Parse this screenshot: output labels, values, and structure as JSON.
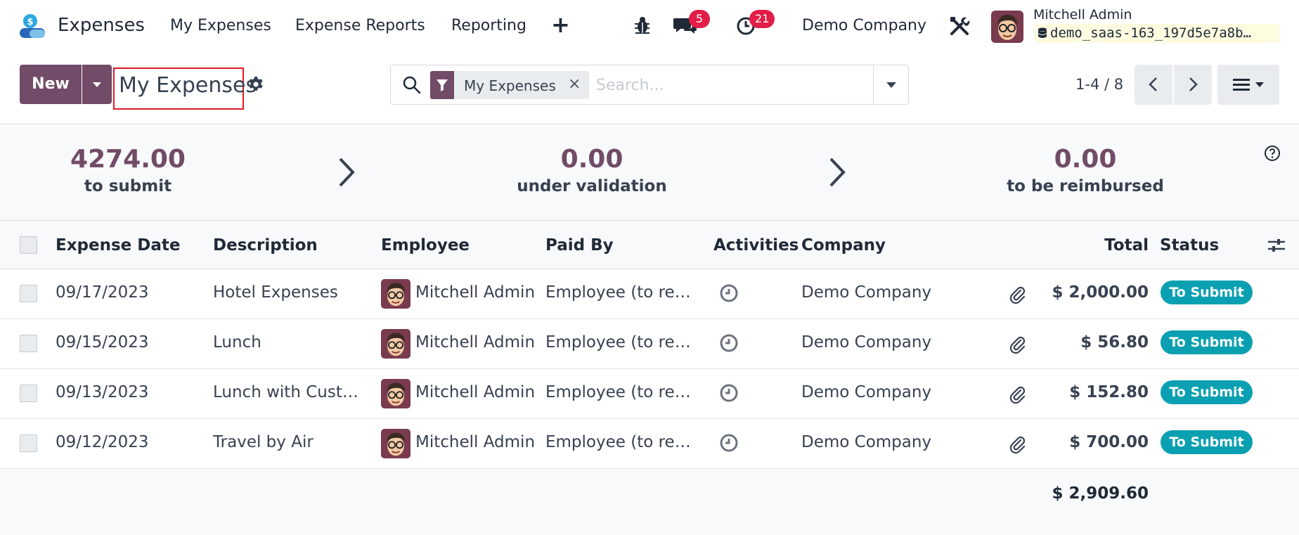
{
  "navbar": {
    "app_title": "Expenses",
    "menu": [
      "My Expenses",
      "Expense Reports",
      "Reporting"
    ],
    "messages_count": "5",
    "activities_count": "21",
    "company": "Demo Company",
    "user_name": "Mitchell Admin",
    "database": "demo_saas-163_197d5e7a8b…"
  },
  "control_panel": {
    "new_label": "New",
    "title": "My Expenses",
    "search": {
      "facet": "My Expenses",
      "facet_remove": "×",
      "placeholder": "Search..."
    },
    "pager": "1-4 / 8"
  },
  "summary": [
    {
      "value": "4274.00",
      "label": "to submit"
    },
    {
      "value": "0.00",
      "label": "under validation"
    },
    {
      "value": "0.00",
      "label": "to be reimbursed"
    }
  ],
  "table": {
    "headers": {
      "date": "Expense Date",
      "description": "Description",
      "employee": "Employee",
      "paid_by": "Paid By",
      "activities": "Activities",
      "company": "Company",
      "total": "Total",
      "status": "Status"
    },
    "rows": [
      {
        "date": "09/17/2023",
        "description": "Hotel Expenses",
        "employee": "Mitchell Admin",
        "paid_by": "Employee (to rei…",
        "company": "Demo Company",
        "total": "$ 2,000.00",
        "status": "To Submit"
      },
      {
        "date": "09/15/2023",
        "description": "Lunch",
        "employee": "Mitchell Admin",
        "paid_by": "Employee (to rei…",
        "company": "Demo Company",
        "total": "$ 56.80",
        "status": "To Submit"
      },
      {
        "date": "09/13/2023",
        "description": "Lunch with Custo…",
        "employee": "Mitchell Admin",
        "paid_by": "Employee (to rei…",
        "company": "Demo Company",
        "total": "$ 152.80",
        "status": "To Submit"
      },
      {
        "date": "09/12/2023",
        "description": "Travel by Air",
        "employee": "Mitchell Admin",
        "paid_by": "Employee (to rei…",
        "company": "Demo Company",
        "total": "$ 700.00",
        "status": "To Submit"
      }
    ],
    "grand_total": "$ 2,909.60"
  },
  "colors": {
    "brand": "#714b67",
    "status_to_submit": "#0aa0b1",
    "badge": "#e11d48",
    "highlight_border": "#e01b24"
  }
}
